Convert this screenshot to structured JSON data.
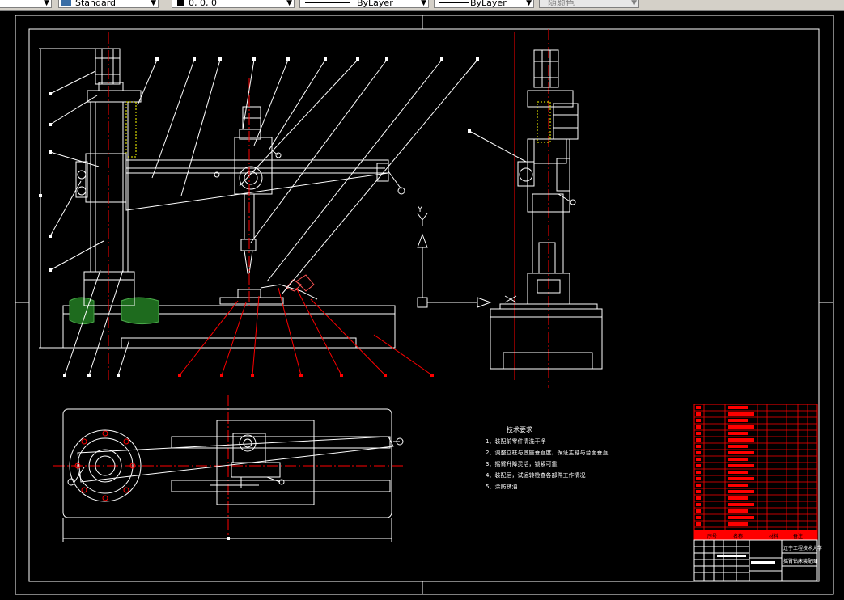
{
  "toolbar": {
    "text_style": "Standard",
    "color_value": "0, 0, 0",
    "linetype": "ByLayer",
    "lineweight": "ByLayer",
    "plotstyle": "随颜色"
  },
  "drawing": {
    "tech_title": "技术要求",
    "tech_notes": [
      "1、装配前零件清洗干净",
      "2、调整立柱与底座垂直度，保证主轴与台面垂直",
      "3、摇臂升降灵活，锁紧可靠",
      "4、装配后，试运转检查各部件工作情况",
      "5、涂防锈油"
    ],
    "title_block": {
      "school": "辽宁工程技术大学",
      "drawing_name": "摇臂钻床装配图"
    },
    "axis_y": "Y",
    "bom_headers": [
      "序号",
      "代号",
      "名称",
      "数量",
      "材料",
      "重量",
      "备注"
    ]
  },
  "colors": {
    "toolbar_bg": "#d4d0c8",
    "canvas_bg": "#000000",
    "line_white": "#ffffff",
    "line_red": "#ff0000",
    "line_green": "#2e8b2e",
    "line_yellow": "#ffff00"
  }
}
